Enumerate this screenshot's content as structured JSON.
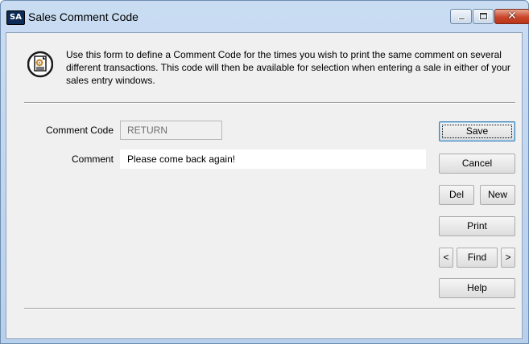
{
  "window": {
    "app_badge": "SA",
    "title": "Sales Comment Code"
  },
  "info": {
    "text": "Use this form to define a Comment Code for the times you wish to print the same comment on several different transactions. This code will then be available for selection when entering a sale in either of your sales entry windows."
  },
  "form": {
    "comment_code_label": "Comment Code",
    "comment_code_value": "RETURN",
    "comment_label": "Comment",
    "comment_value": "Please come back again!"
  },
  "buttons": {
    "save": "Save",
    "cancel": "Cancel",
    "del": "Del",
    "new": "New",
    "print": "Print",
    "prev": "<",
    "find": "Find",
    "next": ">",
    "help": "Help"
  },
  "colors": {
    "title_bar": "#c9dcf2",
    "client_bg": "#f0f0f0",
    "close_button": "#c9462c",
    "default_button_border": "#3c7fb1"
  },
  "icons": {
    "app": "sa-app-icon",
    "info": "document-gear-icon",
    "minimize": "minimize-icon",
    "maximize": "maximize-icon",
    "close": "close-icon"
  }
}
